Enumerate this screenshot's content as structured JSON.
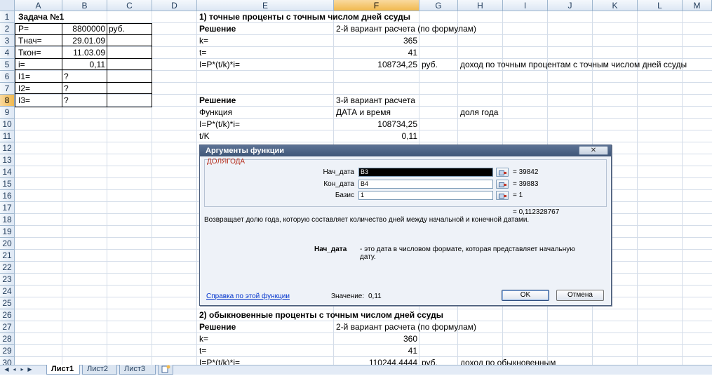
{
  "columns": [
    "A",
    "B",
    "C",
    "D",
    "E",
    "F",
    "G",
    "H",
    "I",
    "J",
    "K",
    "L",
    "M"
  ],
  "selected_column": "F",
  "rows": [
    "1",
    "2",
    "3",
    "4",
    "5",
    "6",
    "7",
    "8",
    "9",
    "10",
    "11",
    "12",
    "13",
    "14",
    "15",
    "16",
    "17",
    "18",
    "19",
    "20",
    "21",
    "22",
    "23",
    "24",
    "25",
    "26",
    "27",
    "28",
    "29",
    "30"
  ],
  "selected_row": "8",
  "cells": {
    "a1": "Задача №1",
    "a2": "P=",
    "b2": "8800000",
    "c2": "руб.",
    "a3": "Тнач=",
    "b3": "29.01.09",
    "a4": "Ткон=",
    "b4": "11.03.09",
    "a5": "i=",
    "b5": "0,11",
    "a6": "I1=",
    "b6": "?",
    "a7": "I2=",
    "b7": "?",
    "a8": "I3=",
    "b8": "?",
    "e1": "1) точные проценты с точным числом дней ссуды",
    "e2": "Решение",
    "f2": "2-й вариант расчета (по формулам)",
    "e3": "k=",
    "f3": "365",
    "e4": "t=",
    "f4": "41",
    "e5": "I=P*(t/k)*i=",
    "f5": "108734,25",
    "g5": "руб.",
    "h5": "доход по точным процентам с точным числом дней ссуды",
    "e8": "Решение",
    "f8": "3-й вариант расчета",
    "e9": "Функция",
    "f9": "ДАТА и время",
    "h9": "доля года",
    "e10": "I=P*(t/k)*i=",
    "f10": "108734,25",
    "e11": "t/K",
    "f11": "0,11",
    "e26": "2) обыкновенные проценты с точным числом дней ссуды",
    "e27": "Решение",
    "f27": "2-й вариант расчета (по формулам)",
    "e28": "k=",
    "f28": "360",
    "e29": "t=",
    "f29": "41",
    "e30": "I=P*(t/k)*i=",
    "f30": "110244,4444",
    "g30": "руб.",
    "h30": "доход по обыкновенным"
  },
  "tabs": {
    "first": "Лист1",
    "second": "Лист2",
    "third": "Лист3"
  },
  "dialog": {
    "title": "Аргументы функции",
    "close": "✕",
    "function_name": "ДОЛЯГОДА",
    "args": [
      {
        "label": "Нач_дата",
        "value": "B3",
        "result": "= 39842"
      },
      {
        "label": "Кон_дата",
        "value": "B4",
        "result": "= 39883"
      },
      {
        "label": "Базис",
        "value": "1",
        "result": "= 1"
      }
    ],
    "formula_result": "= 0,112328767",
    "description": "Возвращает долю года, которую составляет количество дней между начальной и конечной датами.",
    "arg_help_name": "Нач_дата",
    "arg_help_text": "- это дата в числовом формате, которая представляет начальную",
    "arg_help_text2": "дату.",
    "help_link": "Справка по этой функции",
    "value_label": "Значение:",
    "value": "0,11",
    "ok": "OK",
    "cancel": "Отмена"
  },
  "colors": {
    "header_bg": "#dde7f4",
    "selected_header": "#f1b94e",
    "gridline": "#d4dde9",
    "dialog_title": "#3e5577"
  }
}
